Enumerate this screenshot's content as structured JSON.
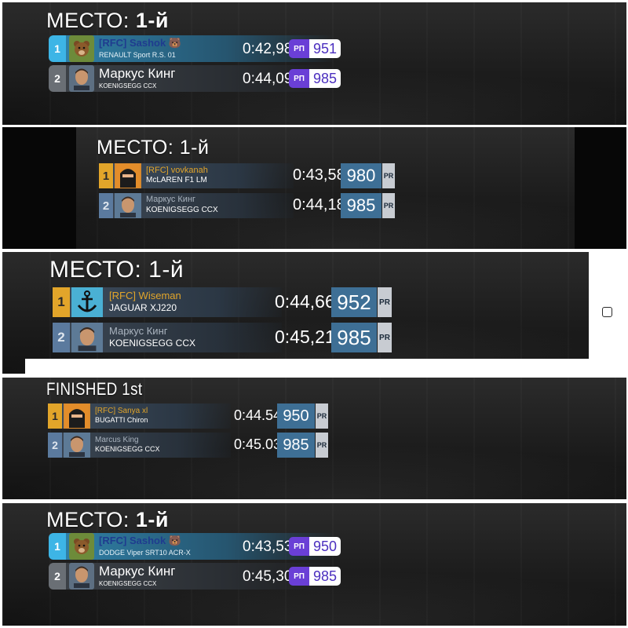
{
  "panels": [
    {
      "title_prefix": "МЕСТО: ",
      "title_place": "1-й",
      "rows": [
        {
          "pos": "1",
          "name": "[RFC] Sashok",
          "emoji": "🐻",
          "car": "RENAULT Sport R.S. 01",
          "time": "0:42,98",
          "badge": "РП",
          "rating": "951"
        },
        {
          "pos": "2",
          "name": "Маркус Кинг",
          "emoji": "",
          "car": "KOENIGSEGG CCX",
          "time": "0:44,09",
          "badge": "РП",
          "rating": "985"
        }
      ]
    },
    {
      "title_prefix": "МЕСТО: ",
      "title_place": "1-й",
      "rows": [
        {
          "pos": "1",
          "name": "[RFC] vovkanah",
          "car": "McLAREN F1 LM",
          "time": "0:43,58",
          "rating": "980",
          "tag": "PR"
        },
        {
          "pos": "2",
          "name": "Маркус Кинг",
          "car": "KOENIGSEGG CCX",
          "time": "0:44,18",
          "rating": "985",
          "tag": "PR"
        }
      ]
    },
    {
      "title_prefix": "МЕСТО: ",
      "title_place": "1-й",
      "rows": [
        {
          "pos": "1",
          "name": "[RFC] Wiseman",
          "car": "JAGUAR XJ220",
          "time": "0:44,66",
          "rating": "952",
          "tag": "PR"
        },
        {
          "pos": "2",
          "name": "Маркус Кинг",
          "car": "KOENIGSEGG CCX",
          "time": "0:45,21",
          "rating": "985",
          "tag": "PR"
        }
      ]
    },
    {
      "title_prefix": "FINISHED ",
      "title_place": "1st",
      "rows": [
        {
          "pos": "1",
          "name": "[RFC] Sanya xl",
          "car": "BUGATTI Chiron",
          "time": "0:44.54",
          "rating": "950",
          "tag": "PR"
        },
        {
          "pos": "2",
          "name": "Marcus King",
          "car": "KOENIGSEGG CCX",
          "time": "0:45.03",
          "rating": "985",
          "tag": "PR"
        }
      ]
    },
    {
      "title_prefix": "МЕСТО: ",
      "title_place": "1-й",
      "rows": [
        {
          "pos": "1",
          "name": "[RFC] Sashok",
          "emoji": "🐻",
          "car": "DODGE Viper SRT10 ACR-X",
          "time": "0:43,53",
          "badge": "РП",
          "rating": "950"
        },
        {
          "pos": "2",
          "name": "Маркус Кинг",
          "emoji": "",
          "car": "KOENIGSEGG CCX",
          "time": "0:45,30",
          "badge": "РП",
          "rating": "985"
        }
      ]
    }
  ],
  "colors": {
    "new_ui_accent": "#3db5e6",
    "new_ui_badge": "#6a3fd6",
    "old_ui_gold": "#e2a52a",
    "old_ui_blue": "#5b7a9e",
    "rating_box_blue": "#3e6f95"
  }
}
